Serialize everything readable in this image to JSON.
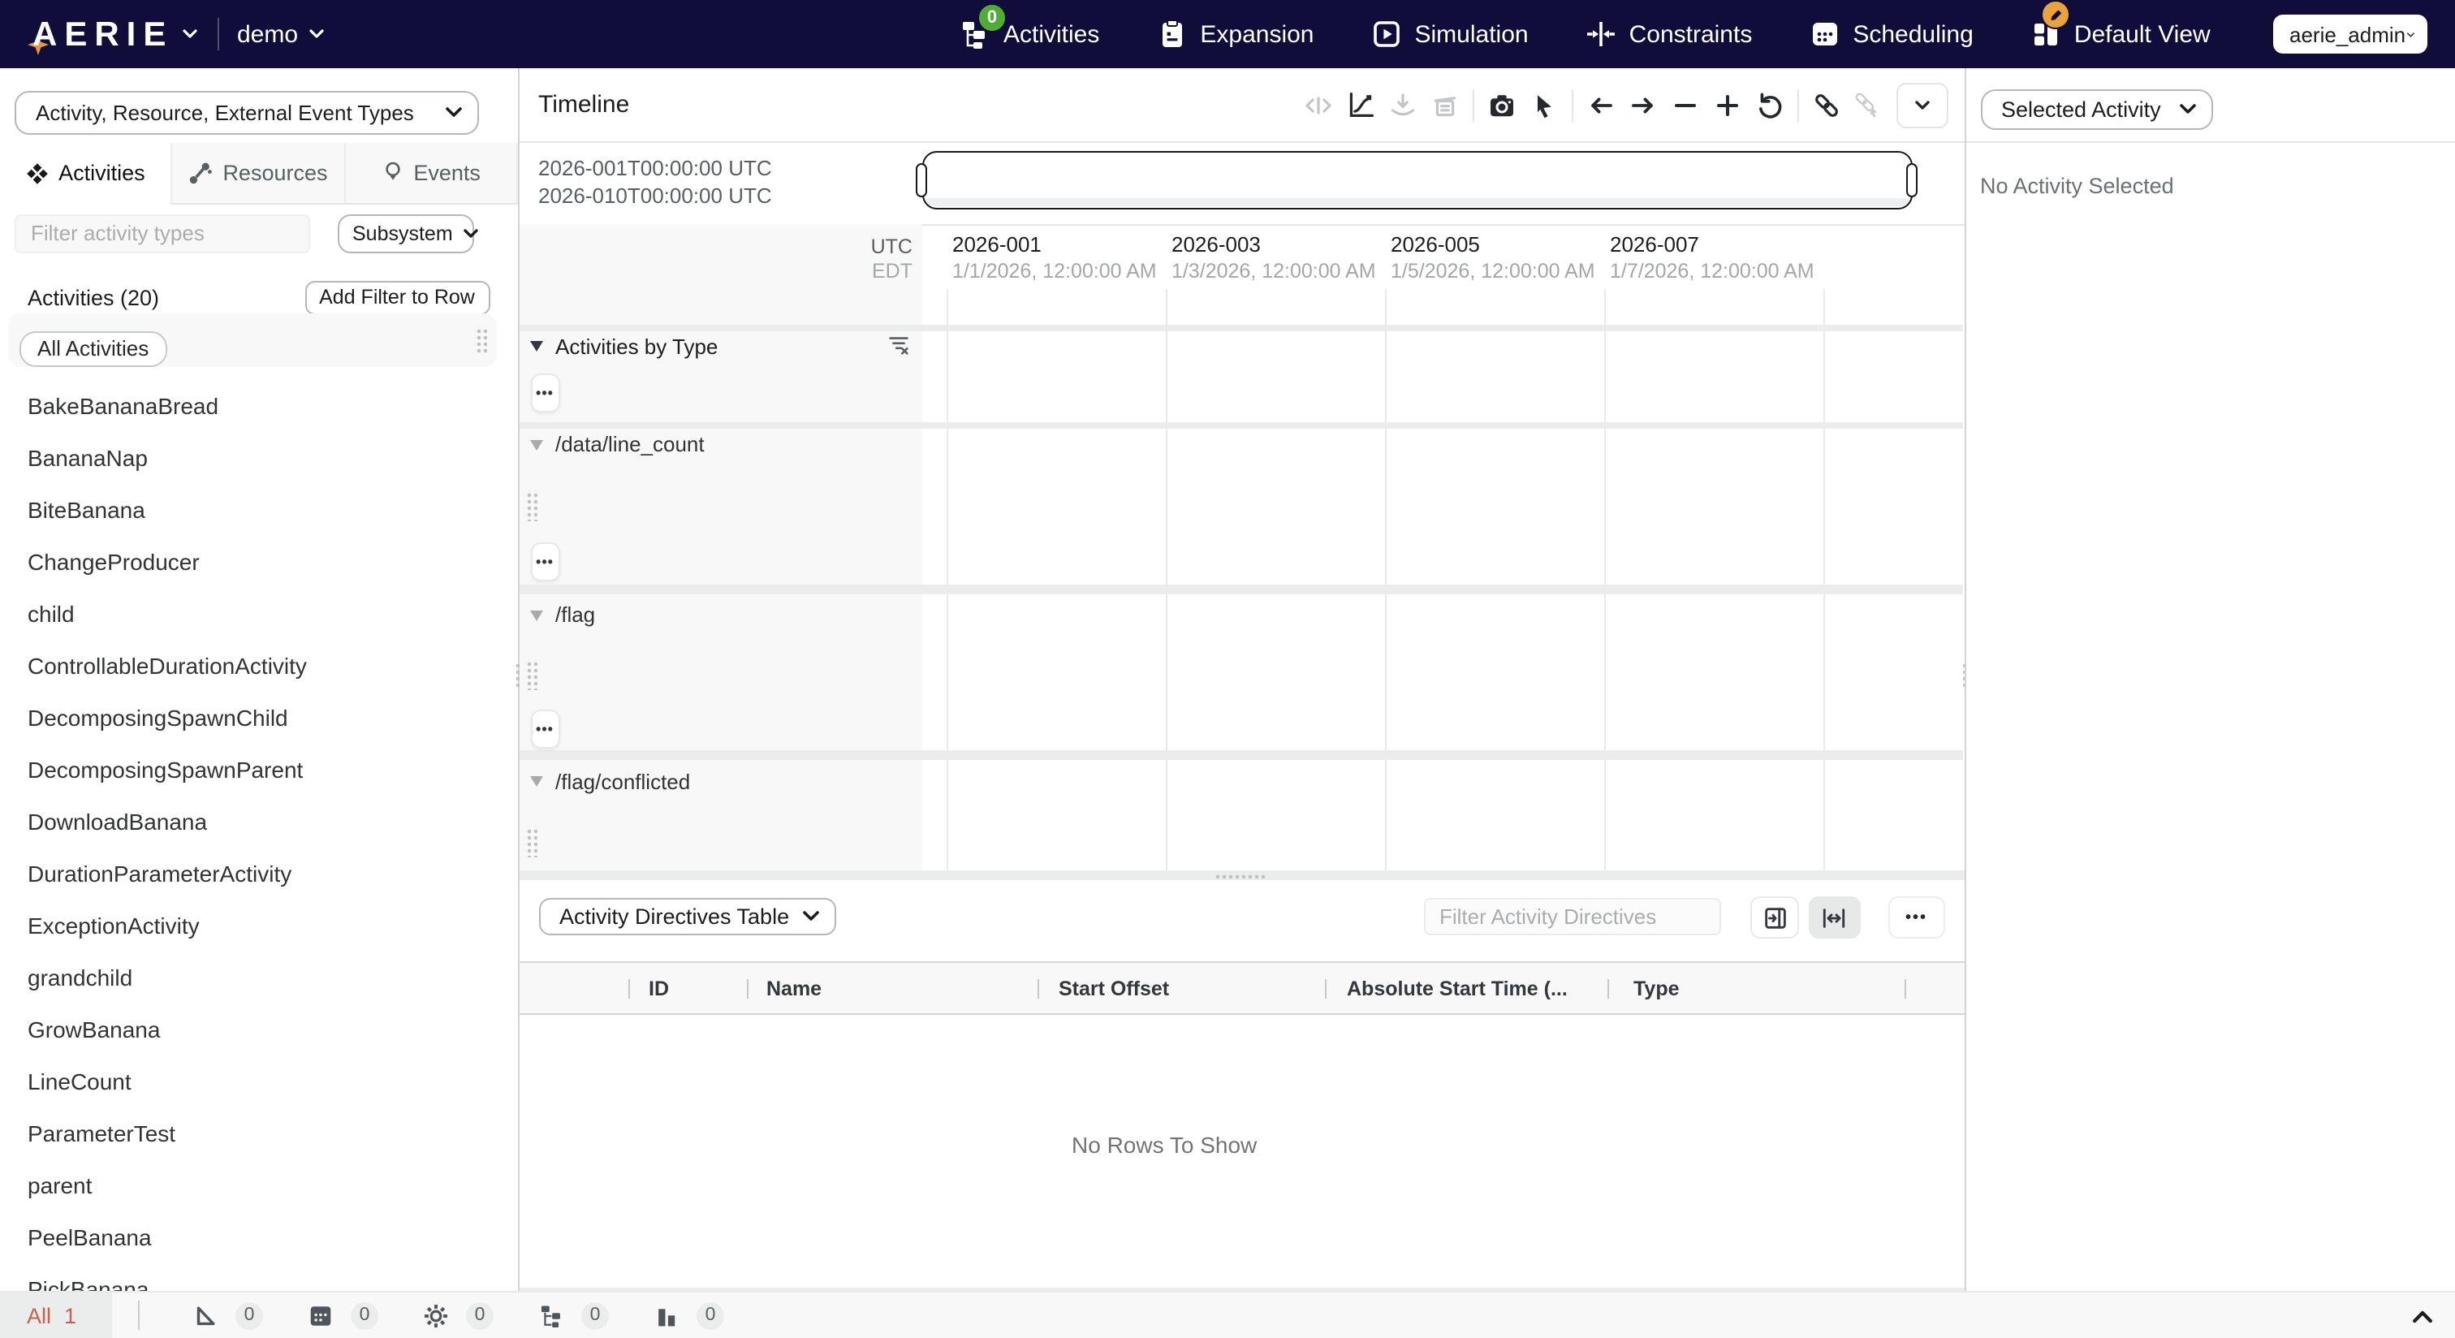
{
  "nav": {
    "logo_text": "AERIE",
    "plan_name": "demo",
    "items": [
      {
        "label": "Activities",
        "badge": "0"
      },
      {
        "label": "Expansion"
      },
      {
        "label": "Simulation"
      },
      {
        "label": "Constraints"
      },
      {
        "label": "Scheduling"
      },
      {
        "label": "Default View",
        "edited_badge": true
      }
    ],
    "user_menu": "aerie_admin"
  },
  "left_panel": {
    "type_selector": "Activity, Resource, External Event Types",
    "tabs": [
      {
        "label": "Activities",
        "active": true
      },
      {
        "label": "Resources",
        "active": false
      },
      {
        "label": "Events",
        "active": false
      }
    ],
    "filter_placeholder": "Filter activity types",
    "subsystem_label": "Subsystem",
    "section_title": "Activities (20)",
    "add_filter_button": "Add Filter to Row",
    "filter_chip": "All Activities",
    "activity_types": [
      "BakeBananaBread",
      "BananaNap",
      "BiteBanana",
      "ChangeProducer",
      "child",
      "ControllableDurationActivity",
      "DecomposingSpawnChild",
      "DecomposingSpawnParent",
      "DownloadBanana",
      "DurationParameterActivity",
      "ExceptionActivity",
      "grandchild",
      "GrowBanana",
      "LineCount",
      "ParameterTest",
      "parent",
      "PeelBanana",
      "PickBanana"
    ]
  },
  "timeline": {
    "panel_title": "Timeline",
    "range_start": "2026-001T00:00:00 UTC",
    "range_end": "2026-010T00:00:00 UTC",
    "timezone_top": "UTC",
    "timezone_bottom": "EDT",
    "ticks": [
      {
        "doy": "2026-001",
        "local": "1/1/2026, 12:00:00 AM"
      },
      {
        "doy": "2026-003",
        "local": "1/3/2026, 12:00:00 AM"
      },
      {
        "doy": "2026-005",
        "local": "1/5/2026, 12:00:00 AM"
      },
      {
        "doy": "2026-007",
        "local": "1/7/2026, 12:00:00 AM"
      }
    ],
    "rows": [
      {
        "label": "Activities by Type"
      },
      {
        "label": "/data/line_count"
      },
      {
        "label": "/flag"
      },
      {
        "label": "/flag/conflicted"
      }
    ]
  },
  "directives_table": {
    "view_selector": "Activity Directives Table",
    "filter_placeholder": "Filter Activity Directives",
    "columns": [
      "ID",
      "Name",
      "Start Offset",
      "Absolute Start Time (...",
      "Type"
    ],
    "empty_message": "No Rows To Show"
  },
  "right_panel": {
    "view_selector": "Selected Activity",
    "empty_message": "No Activity Selected"
  },
  "status_bar": {
    "all_label": "All",
    "all_count": "1",
    "counts": [
      "0",
      "0",
      "0",
      "0",
      "0"
    ]
  },
  "colors": {
    "nav_bg": "#100d3b",
    "badge_green": "#50ac33",
    "badge_orange": "#e8a33d",
    "error_red": "#c8604a",
    "logo_spark": "#e8954c"
  }
}
